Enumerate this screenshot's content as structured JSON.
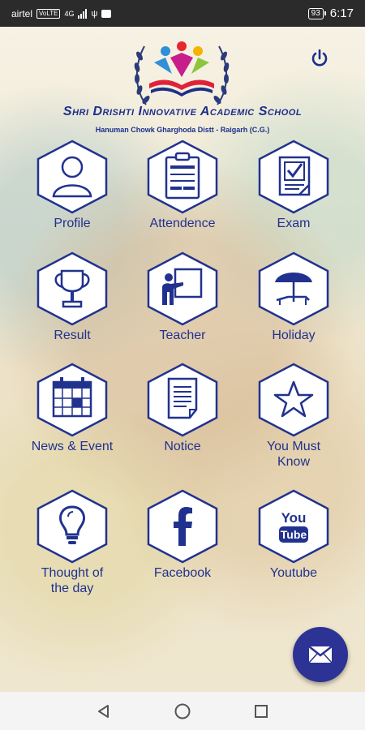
{
  "status_bar": {
    "carrier": "airtel",
    "network_badge": "VoLTE",
    "network_type": "4G",
    "battery": "93",
    "time": "6:17"
  },
  "header": {
    "school_name": "Shri Drishti Innovative Academic School",
    "address": "Hanuman Chowk Gharghoda Distt - Raigarh (C.G.)"
  },
  "tiles": [
    {
      "label": "Profile",
      "icon": "user-icon"
    },
    {
      "label": "Attendence",
      "icon": "clipboard-icon"
    },
    {
      "label": "Exam",
      "icon": "checklist-icon"
    },
    {
      "label": "Result",
      "icon": "trophy-icon"
    },
    {
      "label": "Teacher",
      "icon": "teacher-board-icon"
    },
    {
      "label": "Holiday",
      "icon": "beach-umbrella-icon"
    },
    {
      "label": "News & Event",
      "icon": "calendar-icon"
    },
    {
      "label": "Notice",
      "icon": "document-icon"
    },
    {
      "label": "You Must Know",
      "icon": "star-icon"
    },
    {
      "label": "Thought of the day",
      "icon": "lightbulb-icon"
    },
    {
      "label": "Facebook",
      "icon": "facebook-icon"
    },
    {
      "label": "Youtube",
      "icon": "youtube-icon"
    }
  ],
  "fab": {
    "icon": "mail-icon"
  },
  "nav": {
    "back": "back-icon",
    "home": "home-icon",
    "recents": "recents-icon"
  },
  "colors": {
    "primary": "#21328e",
    "fab": "#2d3394",
    "status_bar": "#2b2b2b"
  }
}
